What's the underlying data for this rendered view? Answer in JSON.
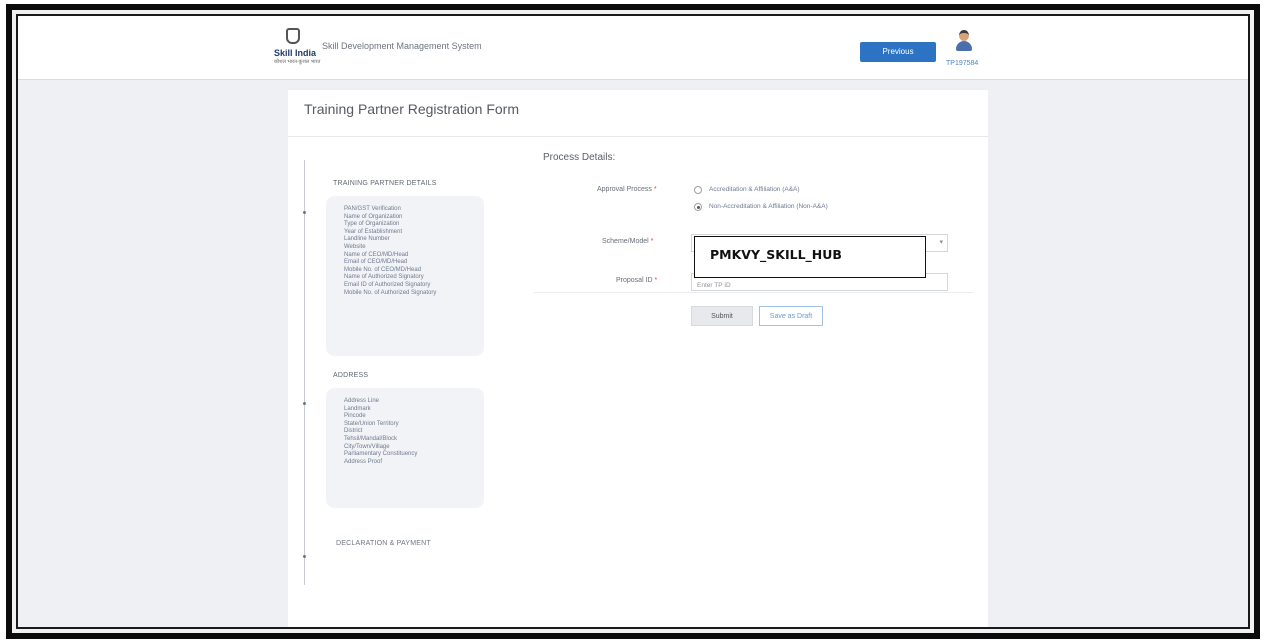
{
  "header": {
    "brand": "Skill India",
    "brand_tagline": "कौशल भारत-कुशल भारत",
    "app_name": "Skill Development Management System",
    "previous_label": "Previous",
    "user_id": "TP197584"
  },
  "form": {
    "title": "Training Partner Registration Form"
  },
  "sidebar": {
    "sections": [
      {
        "title": "TRAINING PARTNER DETAILS",
        "items": [
          "PAN/GST Verification",
          "Name of Organization",
          "Type of Organization",
          "Year of Establishment",
          "Landline Number",
          "Website",
          "Name of CEO/MD/Head",
          "Email of CEO/MD/Head",
          "Mobile No. of CEO/MD/Head",
          "Name of Authorized Signatory",
          "Email ID of Authorized Signatory",
          "Mobile No. of Authorized Signatory"
        ]
      },
      {
        "title": "ADDRESS",
        "items": [
          "Address Line",
          "Landmark",
          "Pincode",
          "State/Union Territory",
          "District",
          "Tehsil/Mandal/Block",
          "City/Town/Village",
          "Parliamentary Constituency",
          "Address Proof"
        ]
      },
      {
        "title": "DECLARATION & PAYMENT",
        "items": []
      }
    ]
  },
  "process": {
    "title": "Process Details:",
    "approval_label": "Approval Process",
    "approval_options": [
      {
        "label": "Accreditation & Affiliation (A&A)",
        "selected": false
      },
      {
        "label": "Non-Accreditation & Affiliation (Non-A&A)",
        "selected": true
      }
    ],
    "scheme_label": "Scheme/Model",
    "scheme_value": "PMKVY_SKILL_HUB",
    "proposal_label": "Proposal ID",
    "proposal_placeholder": "Enter TP ID",
    "submit_label": "Submit",
    "draft_label": "Save as Draft",
    "required_mark": "*"
  },
  "colors": {
    "primary": "#2c74c3",
    "required": "#e0403c",
    "link": "#4b84c8"
  }
}
